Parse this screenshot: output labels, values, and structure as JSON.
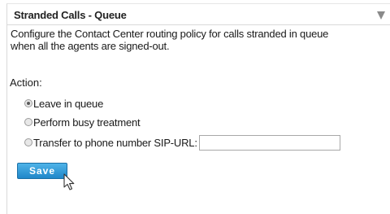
{
  "panel": {
    "title": "Stranded Calls - Queue",
    "description": "Configure the Contact Center routing policy for calls stranded in queue when all the agents are signed-out.",
    "action_label": "Action:",
    "options": [
      {
        "label": "Leave in queue",
        "checked": true
      },
      {
        "label": "Perform busy treatment",
        "checked": false
      },
      {
        "label": "Transfer to phone number SIP-URL:",
        "checked": false
      }
    ],
    "sip_url_value": "",
    "save_label": "Save"
  },
  "icons": {
    "collapse": "triangle-down-icon",
    "cursor": "mouse-pointer-icon"
  }
}
